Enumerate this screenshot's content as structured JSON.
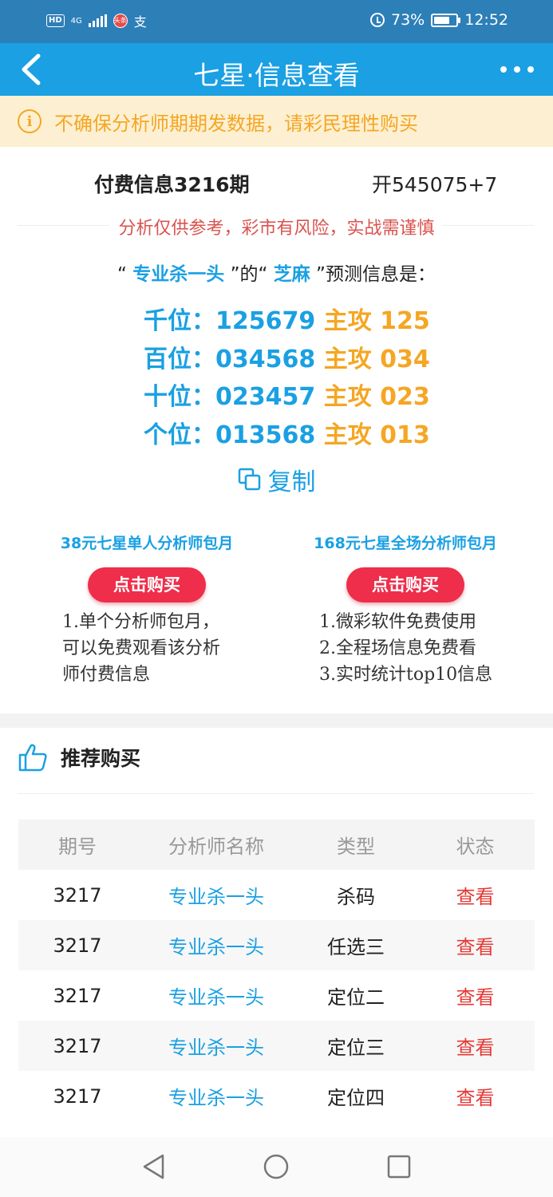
{
  "status_bar": {
    "hd": "HD",
    "network": "4G",
    "mini_app": "头条",
    "zhi": "支",
    "battery": "73%",
    "battery_level": 0.73,
    "time": "12:52"
  },
  "nav": {
    "title": "七星·信息查看"
  },
  "notice": {
    "icon": "i",
    "text": "不确保分析师期期发数据，请彩民理性购买"
  },
  "info": {
    "period": "付费信息3216期",
    "result": "开545075+7",
    "warning": "分析仅供参考，彩市有风险，实战需谨慎",
    "predict_q1": "“",
    "analyst": "专业杀一头",
    "predict_mid": "”的“",
    "nickname": "芝麻",
    "predict_end": "”预测信息是：",
    "rows": [
      {
        "pos": "千位：",
        "nums": "125679",
        "main_label": "主攻",
        "main": "125"
      },
      {
        "pos": "百位：",
        "nums": "034568",
        "main_label": "主攻",
        "main": "034"
      },
      {
        "pos": "十位：",
        "nums": "023457",
        "main_label": "主攻",
        "main": "023"
      },
      {
        "pos": "个位：",
        "nums": "013568",
        "main_label": "主攻",
        "main": "013"
      }
    ],
    "copy_label": "复制"
  },
  "packages": [
    {
      "title": "38元七星单人分析师包月",
      "button": "点击购买",
      "desc": [
        "1.单个分析师包月，",
        "可以免费观看该分析",
        "师付费信息"
      ]
    },
    {
      "title": "168元七星全场分析师包月",
      "button": "点击购买",
      "desc": [
        "1.微彩软件免费使用",
        "2.全程场信息免费看",
        "3.实时统计top10信息"
      ]
    }
  ],
  "recommend": {
    "title": "推荐购买",
    "columns": [
      "期号",
      "分析师名称",
      "类型",
      "状态"
    ],
    "rows": [
      [
        "3217",
        "专业杀一头",
        "杀码",
        "查看"
      ],
      [
        "3217",
        "专业杀一头",
        "任选三",
        "查看"
      ],
      [
        "3217",
        "专业杀一头",
        "定位二",
        "查看"
      ],
      [
        "3217",
        "专业杀一头",
        "定位三",
        "查看"
      ],
      [
        "3217",
        "专业杀一头",
        "定位四",
        "查看"
      ]
    ]
  },
  "colors": {
    "nav": "#1aa0e3",
    "status": "#2d7fb8",
    "accent_orange": "#f5a623",
    "buy_red": "#ee2e4a",
    "view_red": "#e53935"
  }
}
